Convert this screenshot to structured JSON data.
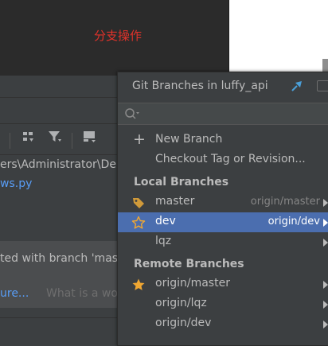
{
  "annotation": {
    "text": "分支操作"
  },
  "ide": {
    "path_text": "ers\\Administrator\\De",
    "file_text": "ws.py",
    "notification": {
      "text": "ted with branch 'mas",
      "link": "ure...",
      "hint": "What is a wo"
    }
  },
  "popup": {
    "title": "Git Branches in luffy_api",
    "actions": [
      {
        "label": "New Branch"
      },
      {
        "label": "Checkout Tag or Revision..."
      }
    ],
    "local_section": "Local Branches",
    "local_branches": [
      {
        "name": "master",
        "tracking": "origin/master",
        "icon": "tag-icon"
      },
      {
        "name": "dev",
        "tracking": "origin/dev",
        "icon": "star-outline-icon",
        "selected": true
      },
      {
        "name": "lqz",
        "tracking": ""
      }
    ],
    "remote_section": "Remote Branches",
    "remote_branches": [
      {
        "name": "origin/master",
        "icon": "star-filled-icon"
      },
      {
        "name": "origin/lqz"
      },
      {
        "name": "origin/dev"
      }
    ]
  },
  "colors": {
    "selection": "#4b6eaf",
    "annotation_red": "#e0322a",
    "star": "#f0a732"
  }
}
